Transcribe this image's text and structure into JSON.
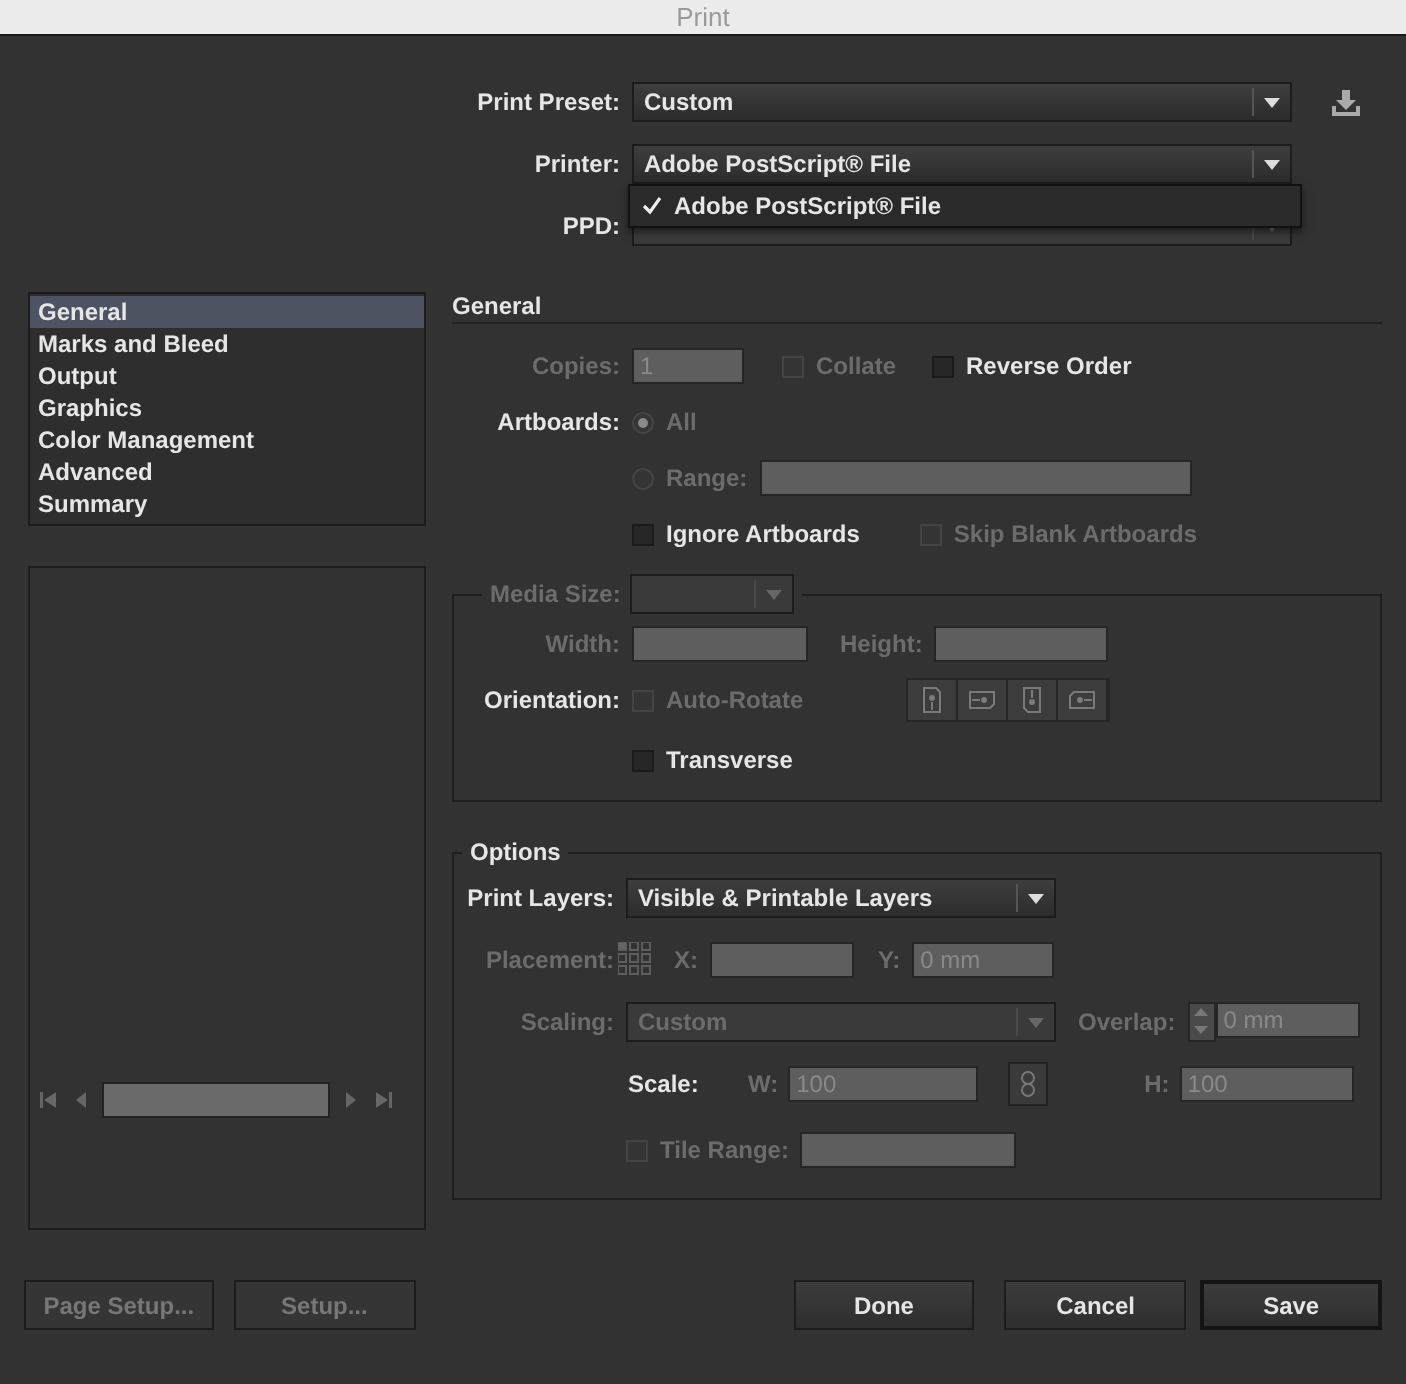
{
  "window": {
    "title": "Print"
  },
  "preset": {
    "label": "Print Preset:",
    "value": "Custom"
  },
  "printer": {
    "label": "Printer:",
    "value": "Adobe PostScript® File",
    "expanded": true
  },
  "printer_menu": [
    {
      "label": "Adobe PostScript® File",
      "checked": true
    }
  ],
  "ppd": {
    "label": "PPD:"
  },
  "sidebar": [
    {
      "label": "General",
      "selected": true
    },
    {
      "label": "Marks and Bleed",
      "selected": false
    },
    {
      "label": "Output",
      "selected": false
    },
    {
      "label": "Graphics",
      "selected": false
    },
    {
      "label": "Color Management",
      "selected": false
    },
    {
      "label": "Advanced",
      "selected": false
    },
    {
      "label": "Summary",
      "selected": false
    }
  ],
  "general": {
    "heading": "General",
    "copies": {
      "label": "Copies:",
      "value": "1",
      "disabled": true
    },
    "collate": {
      "label": "Collate",
      "checked": false,
      "disabled": true
    },
    "reverse_order": {
      "label": "Reverse Order",
      "checked": false,
      "disabled": false
    },
    "artboards": {
      "label": "Artboards:",
      "disabled": false
    },
    "artboard_options": [
      {
        "label": "All",
        "selected": true,
        "disabled": true
      },
      {
        "label": "Range:",
        "selected": false,
        "disabled": true
      }
    ],
    "ignore_artboards": {
      "label": "Ignore Artboards",
      "checked": false,
      "disabled": false
    },
    "skip_blank": {
      "label": "Skip Blank Artboards",
      "checked": false,
      "disabled": true
    }
  },
  "media": {
    "legend": "Media Size:",
    "disabled": true,
    "width": {
      "label": "Width:",
      "disabled": true
    },
    "height": {
      "label": "Height:",
      "disabled": true
    },
    "orientation": {
      "label": "Orientation:",
      "disabled": false
    },
    "auto_rotate": {
      "label": "Auto-Rotate",
      "checked": false,
      "disabled": true
    },
    "transverse": {
      "label": "Transverse",
      "checked": false,
      "disabled": false
    }
  },
  "options": {
    "legend": "Options",
    "print_layers": {
      "label": "Print Layers:",
      "value": "Visible & Printable Layers",
      "disabled": false
    },
    "placement": {
      "label": "Placement:",
      "disabled": true
    },
    "x": {
      "label": "X:",
      "disabled": true
    },
    "y": {
      "label": "Y:",
      "value": "0 mm",
      "disabled": true
    },
    "scaling": {
      "label": "Scaling:",
      "value": "Custom",
      "disabled": true
    },
    "overlap": {
      "label": "Overlap:",
      "value": "0 mm",
      "disabled": true
    },
    "scale": {
      "label": "Scale:",
      "disabled": false
    },
    "w": {
      "label": "W:",
      "value": "100",
      "disabled": true
    },
    "h": {
      "label": "H:",
      "value": "100",
      "disabled": true
    },
    "tile_range": {
      "label": "Tile Range:",
      "checked": false,
      "disabled": true
    }
  },
  "left_buttons": [
    {
      "label": "Page Setup...",
      "disabled": true,
      "default": false
    },
    {
      "label": "Setup...",
      "disabled": true,
      "default": false
    }
  ],
  "right_buttons": [
    {
      "label": "Done",
      "disabled": false,
      "default": false
    },
    {
      "label": "Cancel",
      "disabled": false,
      "default": false
    },
    {
      "label": "Save",
      "disabled": false,
      "default": true
    }
  ]
}
